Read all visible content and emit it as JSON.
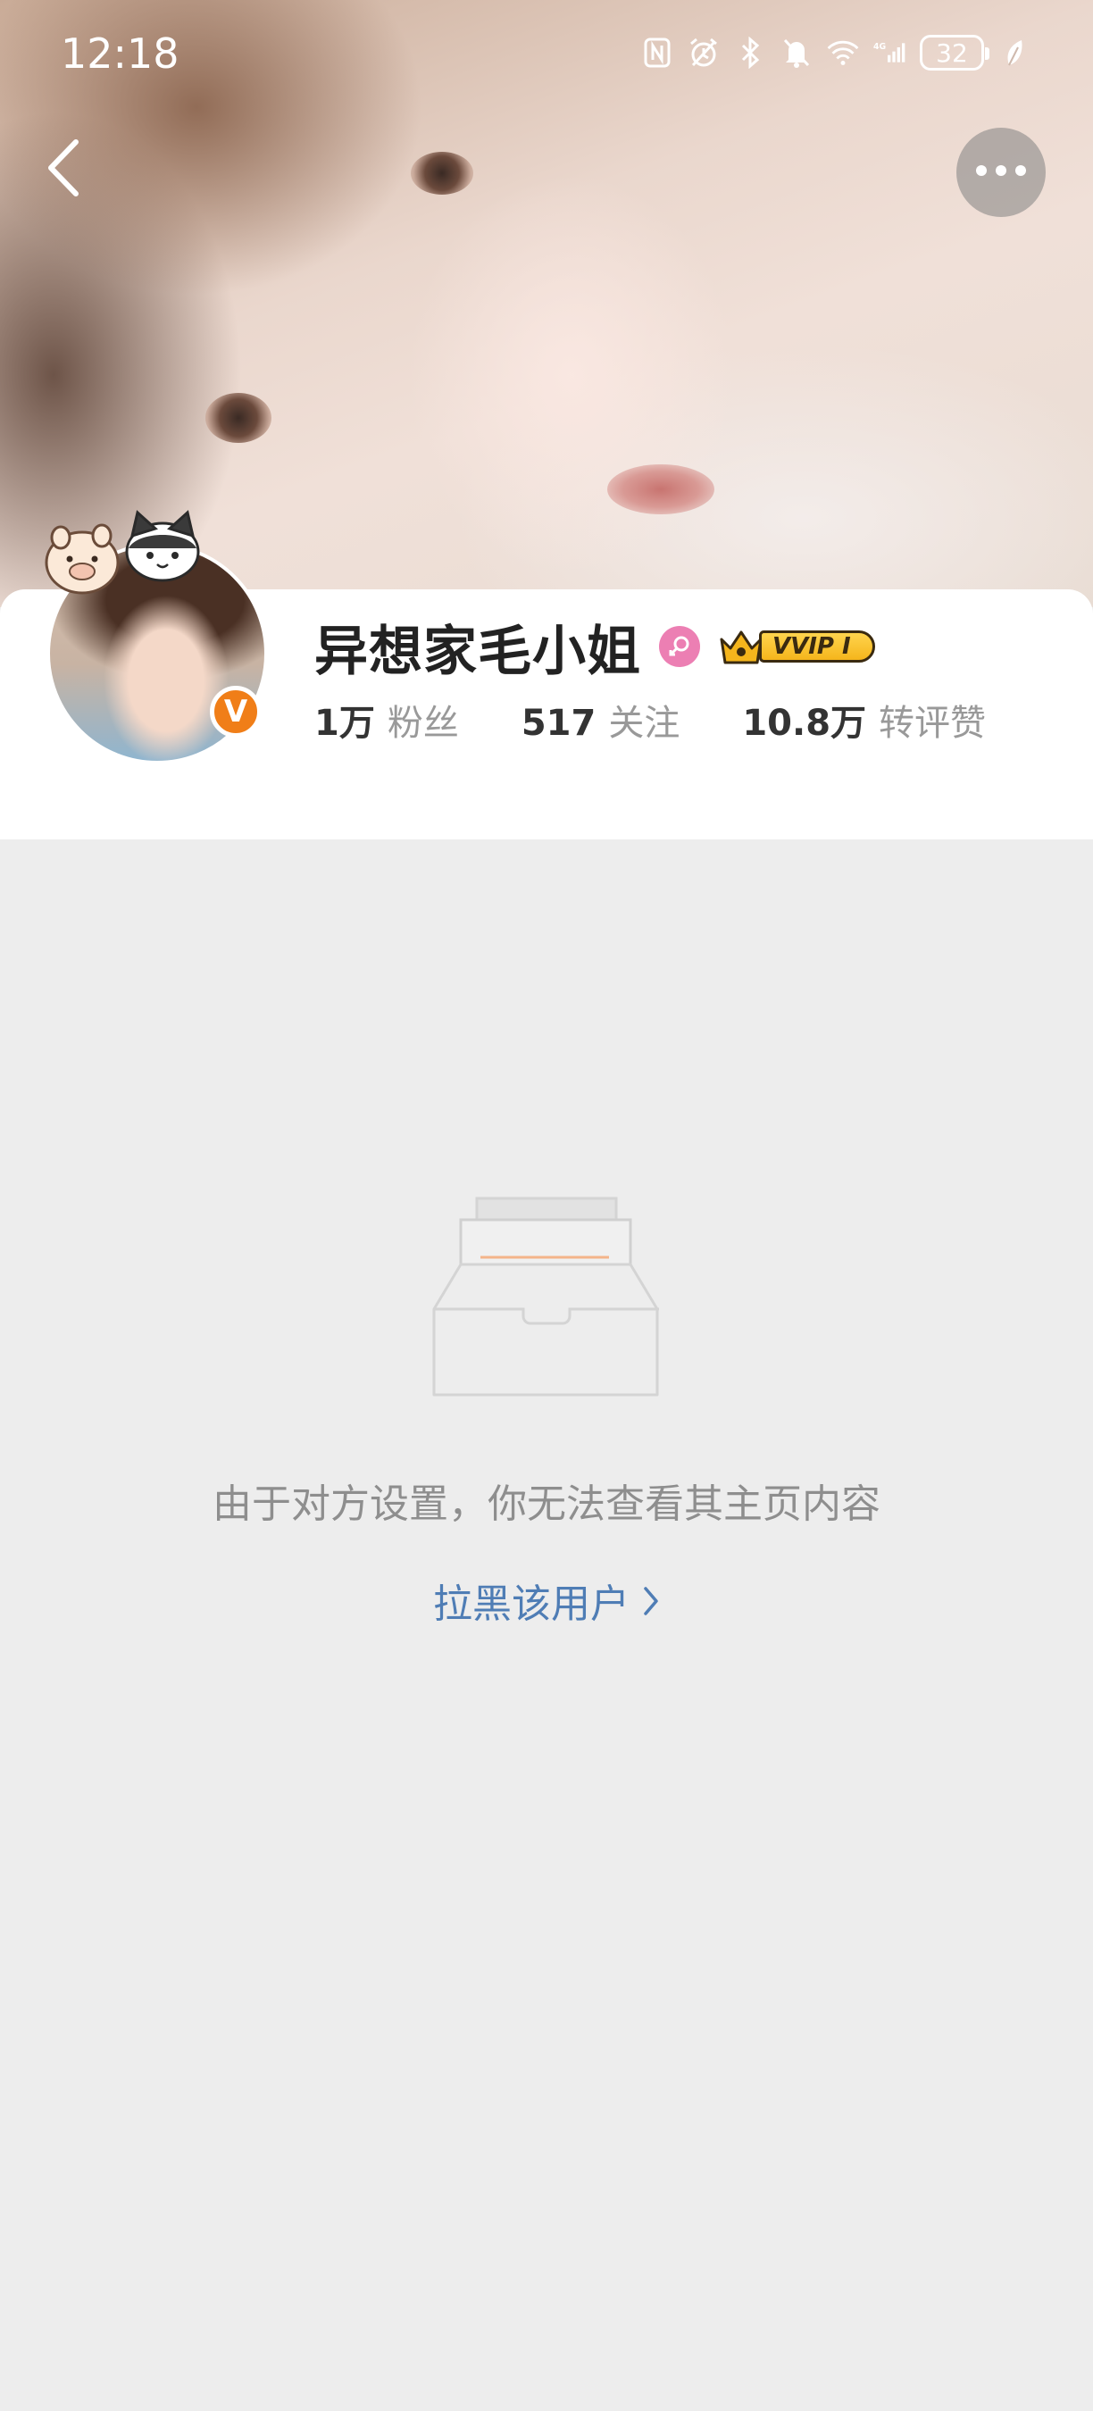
{
  "status_bar": {
    "time": "12:18",
    "battery": "32",
    "network": "4G",
    "icons": [
      "nfc-icon",
      "alarm-icon",
      "bluetooth-icon",
      "mute-icon",
      "wifi-icon",
      "signal-icon",
      "battery-icon",
      "leaf-icon"
    ]
  },
  "nav": {
    "back_icon": "back-arrow-icon",
    "more_icon": "more-horizontal-icon"
  },
  "profile": {
    "name": "异想家毛小姐",
    "gender_icon": "female-icon",
    "vip_label": "VVIP I",
    "verified_label": "V",
    "stats": [
      {
        "value": "1万",
        "label": "粉丝"
      },
      {
        "value": "517",
        "label": "关注"
      },
      {
        "value": "10.8万",
        "label": "转评赞"
      }
    ]
  },
  "empty_state": {
    "illustration": "empty-inbox-icon",
    "message": "由于对方设置，你无法查看其主页内容",
    "block_link": "拉黑该用户",
    "link_icon": "chevron-right-icon"
  },
  "colors": {
    "background": "#ededed",
    "link": "#4f7db5",
    "verified": "#f07e18",
    "gender": "#ec7fb3",
    "vip": "#f5b51c"
  }
}
